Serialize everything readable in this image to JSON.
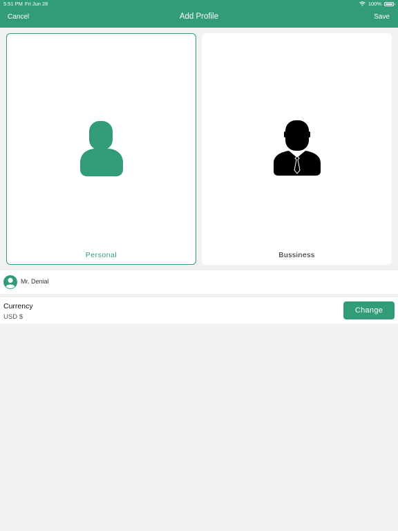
{
  "status_bar": {
    "time": "5:51 PM",
    "date": "Fri Jun 28",
    "battery": "100%"
  },
  "nav": {
    "cancel_label": "Cancel",
    "title": "Add Profile",
    "save_label": "Save"
  },
  "profile_types": [
    {
      "label": "Personal",
      "icon": "person-icon",
      "selected": true
    },
    {
      "label": "Bussiness",
      "icon": "businessman-icon",
      "selected": false
    }
  ],
  "profile_name": "Mr. Denial",
  "currency": {
    "label": "Currency",
    "value": "USD $",
    "change_label": "Change"
  },
  "colors": {
    "accent": "#329b77",
    "background": "#f1f1f1",
    "surface": "#ffffff"
  }
}
